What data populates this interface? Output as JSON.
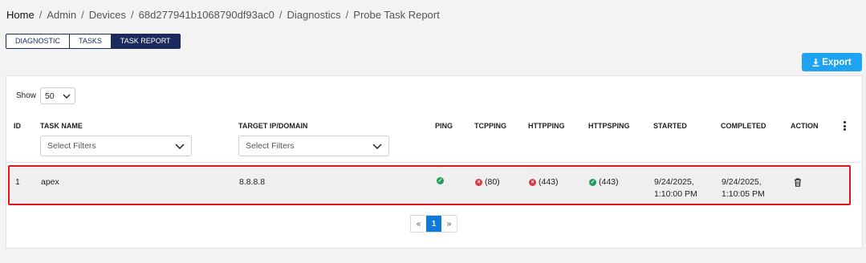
{
  "breadcrumb": {
    "home": "Home",
    "admin": "Admin",
    "devices": "Devices",
    "device_id": "68d277941b1068790df93ac0",
    "diagnostics": "Diagnostics",
    "current": "Probe Task Report",
    "separator": "/"
  },
  "tabs": [
    {
      "label": "DIAGNOSTIC",
      "active": false
    },
    {
      "label": "TASKS",
      "active": false
    },
    {
      "label": "TASK REPORT",
      "active": true
    }
  ],
  "export": {
    "label": "Export",
    "icon": "download-icon",
    "color": "#1ea3f2"
  },
  "show": {
    "label": "Show",
    "value": "50"
  },
  "columns": {
    "id": "ID",
    "task_name": "TASK NAME",
    "target": "TARGET IP/DOMAIN",
    "ping": "PING",
    "tcpping": "TCPPING",
    "httpping": "HTTPPING",
    "httpsping": "HTTPSPING",
    "started": "STARTED",
    "completed": "COMPLETED",
    "action": "ACTION"
  },
  "filters": {
    "task_name_placeholder": "Select Filters",
    "target_placeholder": "Select Filters"
  },
  "rows": [
    {
      "id": "1",
      "task_name": "apex",
      "target": "8.8.8.8",
      "ping": {
        "status": "ok",
        "text": ""
      },
      "tcpping": {
        "status": "error",
        "text": "(80)"
      },
      "httpping": {
        "status": "error",
        "text": "(443)"
      },
      "httpsping": {
        "status": "ok",
        "text": "(443)"
      },
      "started_date": "9/24/2025,",
      "started_time": "1:10:00 PM",
      "completed_date": "9/24/2025,",
      "completed_time": "1:10:05 PM",
      "action_icon": "trash-icon"
    }
  ],
  "pagination": {
    "prev": "«",
    "current": "1",
    "next": "»"
  },
  "colors": {
    "accent": "#1b2a5c",
    "ok": "#1e9c5a",
    "error": "#d93a45",
    "highlight_border": "#e0161e",
    "page_active": "#0c7bdc"
  }
}
